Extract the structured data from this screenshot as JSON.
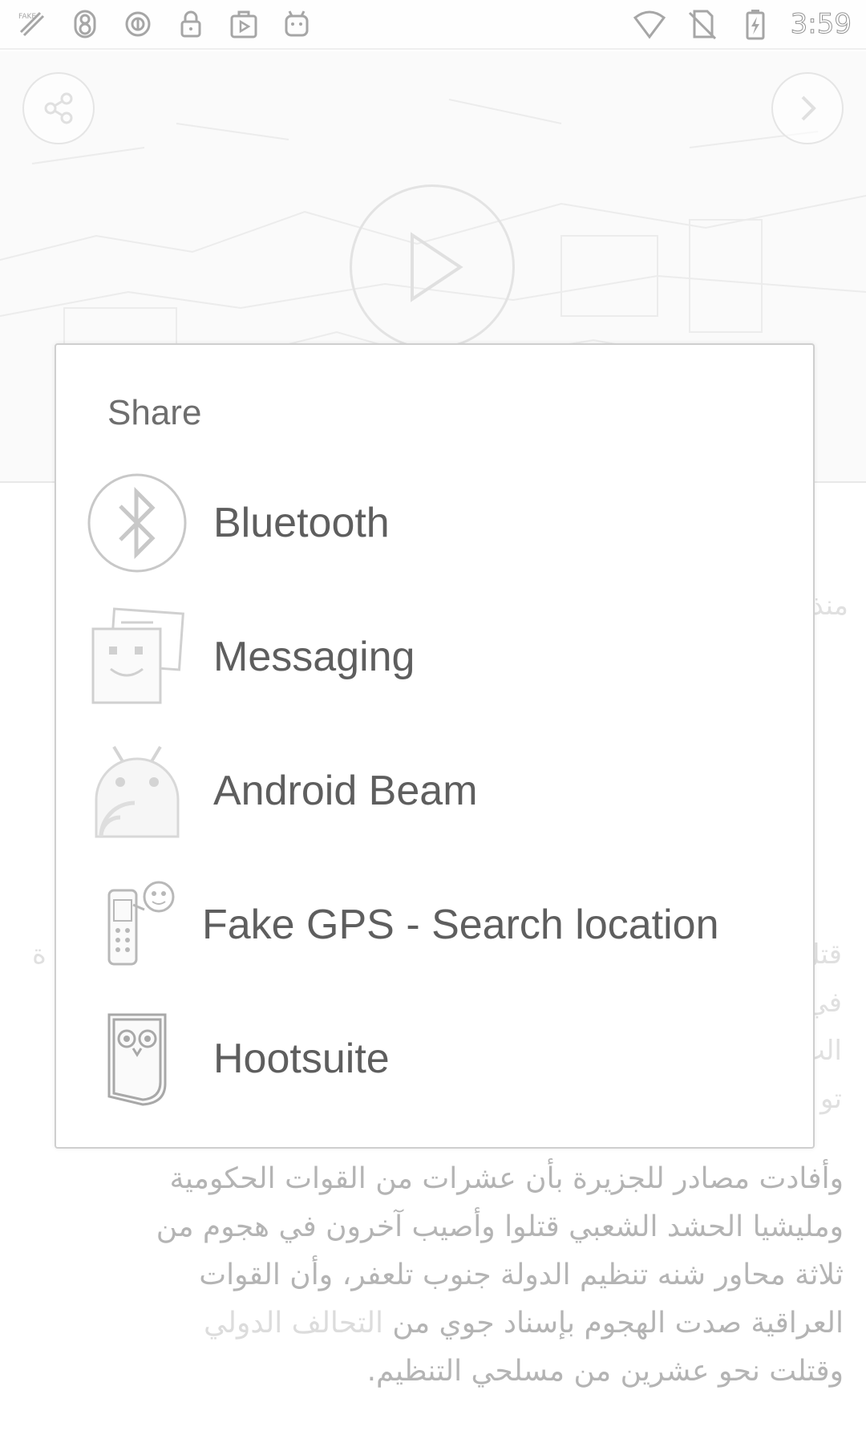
{
  "status_bar": {
    "time": "3:59",
    "left_icons": [
      "fake-gps-icon",
      "notification-8-icon",
      "data-saver-icon",
      "lock-icon",
      "media-icon",
      "android-icon"
    ],
    "right_icons": [
      "wifi-icon",
      "no-sim-icon",
      "battery-charging-icon"
    ]
  },
  "share_dialog": {
    "title": "Share",
    "items": [
      {
        "label": "Bluetooth",
        "icon": "bluetooth-icon"
      },
      {
        "label": "Messaging",
        "icon": "messaging-icon"
      },
      {
        "label": "Android Beam",
        "icon": "android-beam-icon"
      },
      {
        "label": "Fake GPS - Search location",
        "icon": "fake-gps-app-icon"
      },
      {
        "label": "Hootsuite",
        "icon": "hootsuite-owl-icon"
      }
    ]
  },
  "article": {
    "lines": [
      "وأفادت مصادر للجزيرة بأن عشرات من القوات الحكومية",
      "ومليشيا الحشد الشعبي قتلوا وأصيب آخرون في هجوم من",
      "ثلاثة محاور شنه تنظيم الدولة جنوب تلعفر، وأن القوات",
      "العراقية صدت الهجوم بإسناد جوي من",
      "وقتلت نحو عشرين من مسلحي التنظيم."
    ],
    "link_text": "التحالف الدولي",
    "side_fragments": [
      "منذ",
      "قتل",
      "في",
      "الت",
      "تو",
      "ة"
    ]
  }
}
